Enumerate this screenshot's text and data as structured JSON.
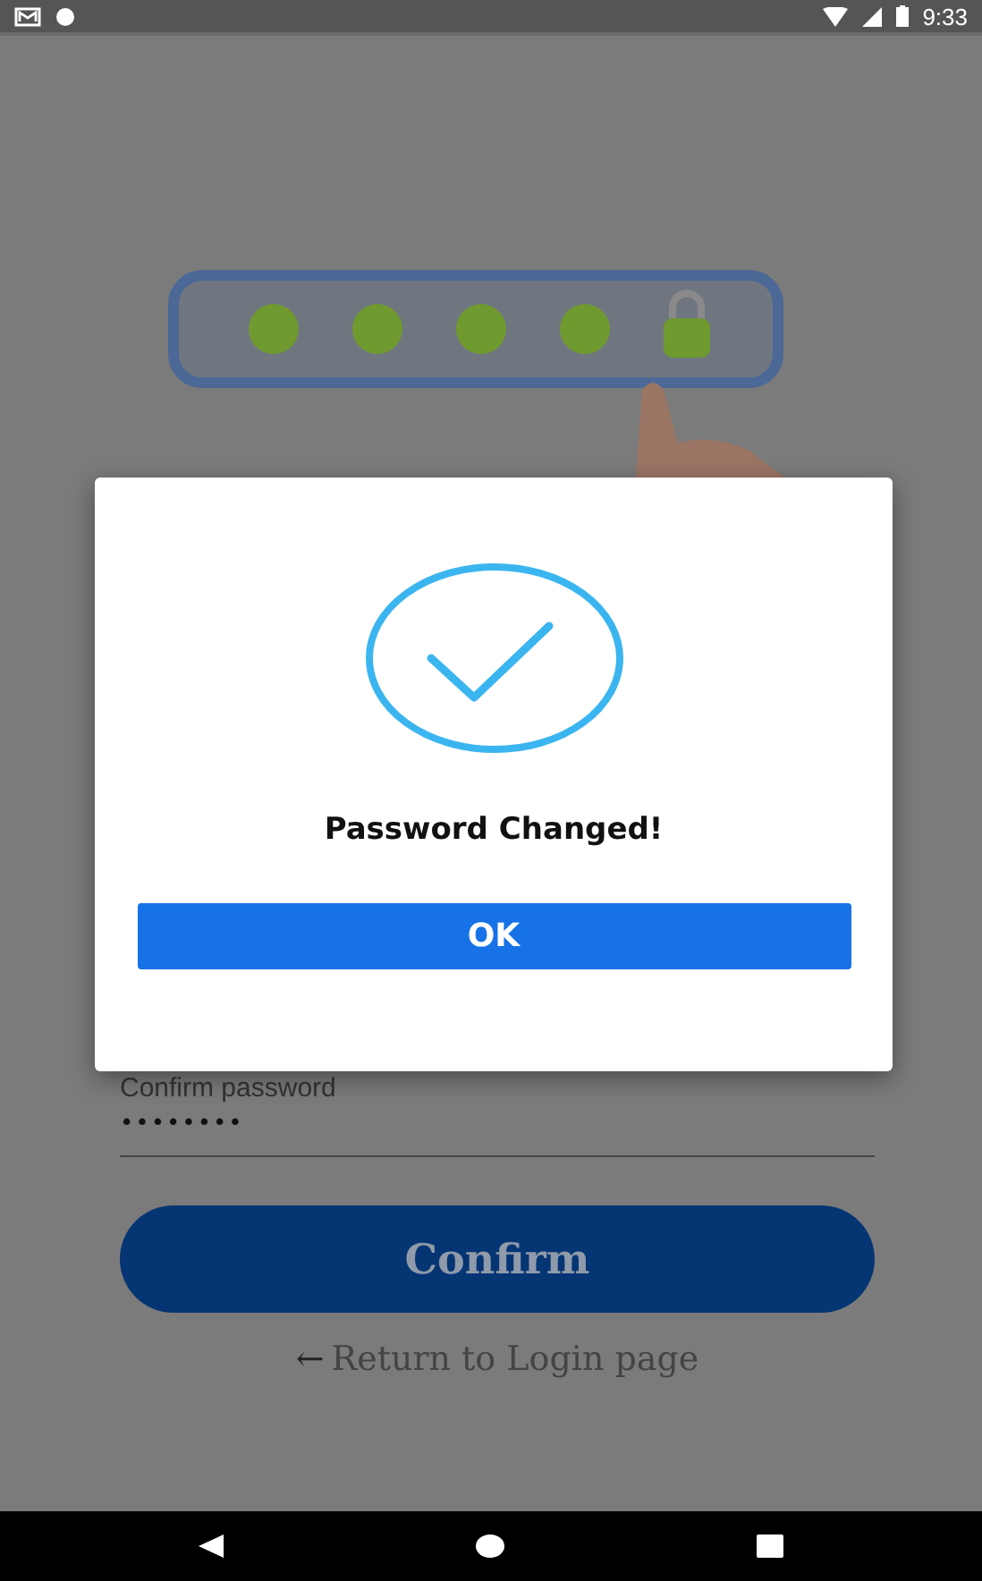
{
  "status_bar": {
    "time": "9:33"
  },
  "form": {
    "confirm_password": {
      "label": "Confirm password",
      "value": "••••••••"
    },
    "confirm_button": "Confirm",
    "return_link": {
      "icon": "←",
      "label": "Return to Login page"
    }
  },
  "dialog": {
    "message": "Password Changed!",
    "button": "OK"
  }
}
